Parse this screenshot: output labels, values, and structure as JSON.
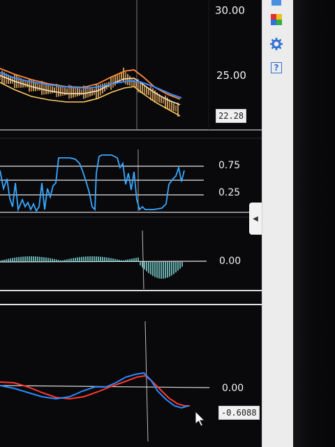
{
  "panels": {
    "price": {
      "axis_labels": [
        "30.00",
        "25.00"
      ],
      "last_price": "22.28",
      "colors": {
        "upper_band": "#ff8a3d",
        "lower_band": "#ffcc66",
        "mid": "#ffe7c0",
        "ma": "#3d8bff"
      }
    },
    "stochastic": {
      "axis_labels": [
        "0.75",
        "0.25"
      ],
      "line_color": "#39a8ff"
    },
    "histogram": {
      "axis_label": "0.00",
      "bar_color": "#8ff3ef"
    },
    "macd": {
      "axis_label": "0.00",
      "last_value": "-0.6088",
      "colors": {
        "signal": "#ff3a2e",
        "macd": "#2a8cff"
      }
    }
  },
  "toolbar": {
    "icons": [
      "color-palette-icon",
      "settings-gear-icon",
      "help-icon"
    ],
    "help_glyph": "?"
  },
  "accent": {
    "grid_line": "#e6e6e6",
    "crosshair": "#bfbfbf"
  }
}
